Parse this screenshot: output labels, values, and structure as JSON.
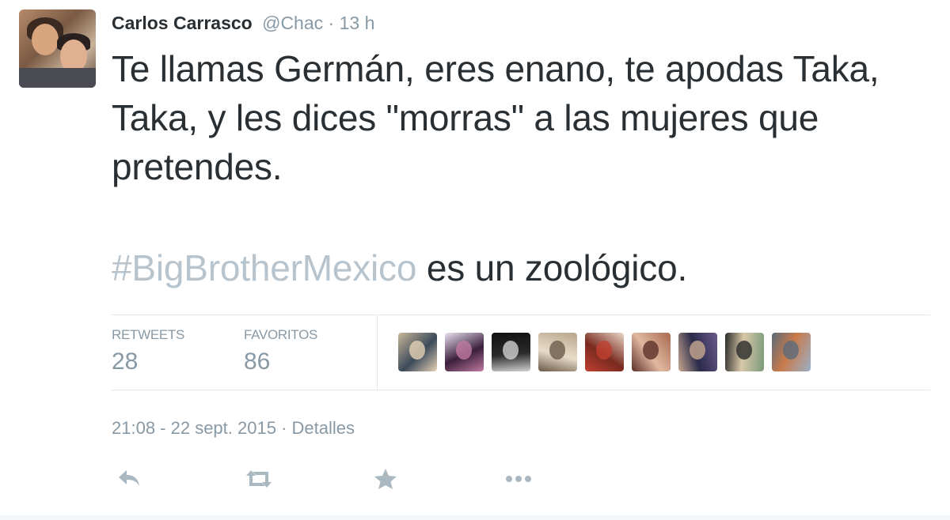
{
  "author": {
    "name": "Carlos Carrasco",
    "handle": "@Chac",
    "separator": "·",
    "time": "13 h"
  },
  "tweet": {
    "line1": "Te llamas Germán, eres enano, te apodas Taka, Taka, y les dices \"morras\" a las mujeres que pretendes.",
    "hashtag": "#BigBrotherMexico",
    "line2_rest": " es un zoológico."
  },
  "stats": {
    "retweets_label": "RETWEETS",
    "retweets_count": "28",
    "favorites_label": "FAVORITOS",
    "favorites_count": "86"
  },
  "favoriters": [
    {
      "name": "favoriter-1",
      "colors": [
        "#c8b79a",
        "#3c4a5a",
        "#e6d3b5"
      ]
    },
    {
      "name": "favoriter-2",
      "colors": [
        "#e9e1f0",
        "#3b1f3c",
        "#c07aa0"
      ]
    },
    {
      "name": "favoriter-3",
      "colors": [
        "#101010",
        "#2a2a2a",
        "#d0d0d0"
      ]
    },
    {
      "name": "favoriter-4",
      "colors": [
        "#b8a48c",
        "#e8dcc8",
        "#6a5a48"
      ]
    },
    {
      "name": "favoriter-5",
      "colors": [
        "#e8d8c8",
        "#7a2a20",
        "#c04030"
      ]
    },
    {
      "name": "favoriter-6",
      "colors": [
        "#a86a50",
        "#e0b8a0",
        "#5a3028"
      ]
    },
    {
      "name": "favoriter-7",
      "colors": [
        "#6a5a8a",
        "#2a2a4a",
        "#c8a890"
      ]
    },
    {
      "name": "favoriter-8",
      "colors": [
        "#7a9a7a",
        "#d8c8a8",
        "#2a2a2a"
      ]
    },
    {
      "name": "favoriter-9",
      "colors": [
        "#9ab0c8",
        "#c87a4a",
        "#5a6a7a"
      ]
    }
  ],
  "meta": {
    "timestamp": "21:08 - 22 sept. 2015",
    "separator": "·",
    "details_link": "Detalles"
  },
  "actions": {
    "reply_icon": "reply-icon",
    "retweet_icon": "retweet-icon",
    "favorite_icon": "star-icon",
    "more_icon": "more-icon"
  },
  "colors": {
    "text": "#292f33",
    "muted": "#8899a6",
    "hashtag": "#b8c4cd",
    "divider": "#e1e8ed",
    "icon": "#aab8c2"
  }
}
